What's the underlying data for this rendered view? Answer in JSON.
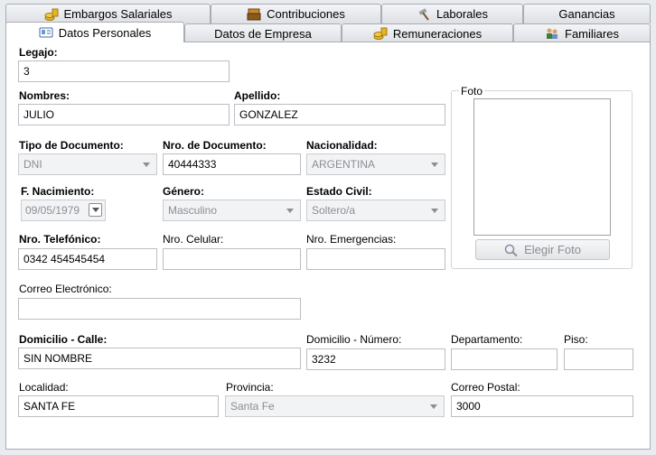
{
  "tabs_back": [
    {
      "label": "Embargos Salariales",
      "icon": "coins-icon"
    },
    {
      "label": "Contribuciones",
      "icon": "cash-register-icon"
    },
    {
      "label": "Laborales",
      "icon": "hammer-icon"
    },
    {
      "label": "Ganancias",
      "icon": ""
    }
  ],
  "tabs_front": [
    {
      "label": "Datos Personales",
      "icon": "id-card-icon",
      "active": true
    },
    {
      "label": "Datos de Empresa",
      "icon": ""
    },
    {
      "label": "Remuneraciones",
      "icon": "coins-icon"
    },
    {
      "label": "Familiares",
      "icon": "family-icon"
    }
  ],
  "form": {
    "legajo": {
      "label": "Legajo:",
      "value": "3"
    },
    "nombres": {
      "label": "Nombres:",
      "value": "JULIO"
    },
    "apellido": {
      "label": "Apellido:",
      "value": "GONZALEZ"
    },
    "tipo_doc": {
      "label": "Tipo de Documento:",
      "value": "DNI"
    },
    "nro_doc": {
      "label": "Nro. de Documento:",
      "value": "40444333"
    },
    "nacionalidad": {
      "label": "Nacionalidad:",
      "value": "ARGENTINA"
    },
    "nacimiento": {
      "label": "F. Nacimiento:",
      "value": "09/05/1979"
    },
    "genero": {
      "label": "Género:",
      "value": "Masculino"
    },
    "estado_civil": {
      "label": "Estado Civil:",
      "value": "Soltero/a"
    },
    "telefono": {
      "label": "Nro. Telefónico:",
      "value": "0342 454545454"
    },
    "celular": {
      "label": "Nro. Celular:",
      "value": ""
    },
    "emergencias": {
      "label": "Nro. Emergencias:",
      "value": ""
    },
    "correo": {
      "label": "Correo Electrónico:",
      "value": ""
    },
    "calle": {
      "label": "Domicilio - Calle:",
      "value": "SIN NOMBRE"
    },
    "numero": {
      "label": "Domicilio - Número:",
      "value": "3232"
    },
    "departamento": {
      "label": "Departamento:",
      "value": ""
    },
    "piso": {
      "label": "Piso:",
      "value": ""
    },
    "localidad": {
      "label": "Localidad:",
      "value": "SANTA FE"
    },
    "provincia": {
      "label": "Provincia:",
      "value": "Santa Fe"
    },
    "correo_postal": {
      "label": "Correo Postal:",
      "value": "3000"
    }
  },
  "foto": {
    "legend": "Foto",
    "button": "Elegir Foto"
  },
  "colors": {
    "gold": "#e6b422",
    "border": "#a8acb3"
  }
}
